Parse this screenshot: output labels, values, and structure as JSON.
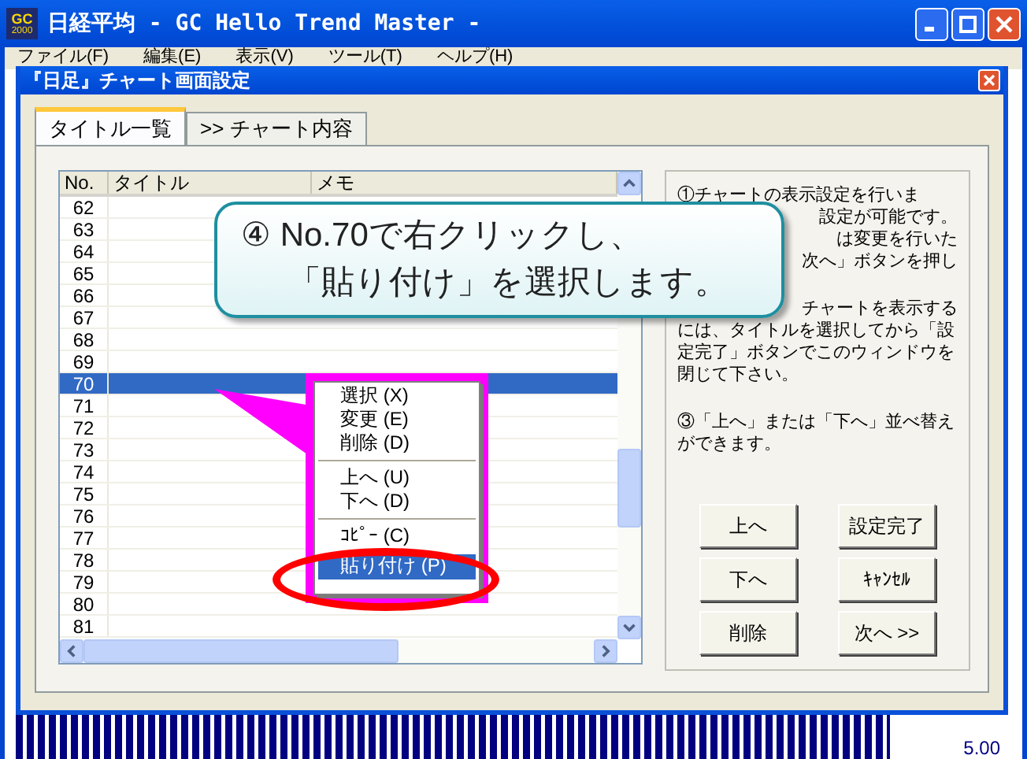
{
  "window": {
    "app_icon": {
      "line_1": "GC",
      "line_2": "2000"
    },
    "title": "日経平均 - GC Hello Trend Master -"
  },
  "menu_bar": [
    "ファイル(F)",
    "編集(E)",
    "表示(V)",
    "ツール(T)",
    "ヘルプ(H)"
  ],
  "dialog": {
    "title": "『日足』チャート画面設定",
    "tabs": [
      {
        "label": "タイトル一覧",
        "selected": true
      },
      {
        "label": ">> チャート内容",
        "selected": false
      }
    ],
    "table": {
      "columns": [
        "No.",
        "タイトル",
        "メモ"
      ],
      "rows": [
        {
          "no": "62",
          "selected": false
        },
        {
          "no": "63",
          "selected": false
        },
        {
          "no": "64",
          "selected": false
        },
        {
          "no": "65",
          "selected": false
        },
        {
          "no": "66",
          "selected": false
        },
        {
          "no": "67",
          "selected": false
        },
        {
          "no": "68",
          "selected": false
        },
        {
          "no": "69",
          "selected": false
        },
        {
          "no": "70",
          "selected": true
        },
        {
          "no": "71",
          "selected": false
        },
        {
          "no": "72",
          "selected": false
        },
        {
          "no": "73",
          "selected": false
        },
        {
          "no": "74",
          "selected": false
        },
        {
          "no": "75",
          "selected": false
        },
        {
          "no": "76",
          "selected": false
        },
        {
          "no": "77",
          "selected": false
        },
        {
          "no": "78",
          "selected": false
        },
        {
          "no": "79",
          "selected": false
        },
        {
          "no": "80",
          "selected": false
        },
        {
          "no": "81",
          "selected": false
        }
      ]
    },
    "info_paragraphs": [
      [
        {
          "text": "①チャートの表示設定を行いま",
          "kind": "full"
        },
        {
          "text": "設定が可能です。",
          "kind": "partial"
        },
        {
          "text": "は変更を行いた",
          "kind": "partial"
        },
        {
          "text": "次へ」ボタンを押し",
          "kind": "partial"
        }
      ],
      [
        {
          "text": "チャートを表示する",
          "kind": "partial"
        },
        {
          "text": "には、タイトルを選択してから「設",
          "kind": "full"
        },
        {
          "text": "定完了」ボタンでこのウィンドウを",
          "kind": "full"
        },
        {
          "text": "閉じて下さい。",
          "kind": "full"
        }
      ],
      [
        {
          "text": "③「上へ」または「下へ」並べ替え",
          "kind": "full"
        },
        {
          "text": "ができます。",
          "kind": "full"
        }
      ]
    ],
    "buttons": [
      "上へ",
      "設定完了",
      "下へ",
      "ｷｬﾝｾﾙ",
      "削除",
      "次へ >>"
    ]
  },
  "context_menu": [
    {
      "kind": "item",
      "label": "選択 (X)",
      "selected": false
    },
    {
      "kind": "item",
      "label": "変更 (E)",
      "selected": false
    },
    {
      "kind": "item",
      "label": "削除 (D)",
      "selected": false
    },
    {
      "kind": "separator"
    },
    {
      "kind": "item",
      "label": "上へ (U)",
      "selected": false
    },
    {
      "kind": "item",
      "label": "下へ (D)",
      "selected": false
    },
    {
      "kind": "separator"
    },
    {
      "kind": "item",
      "label": "ｺﾋﾟｰ (C)",
      "selected": false
    },
    {
      "kind": "item",
      "label": "貼り付け (P)",
      "selected": true
    }
  ],
  "callout": {
    "lines": [
      "④ No.70で右クリックし、",
      "「貼り付け」を選択します。"
    ]
  },
  "chart_reading": "5.00"
}
